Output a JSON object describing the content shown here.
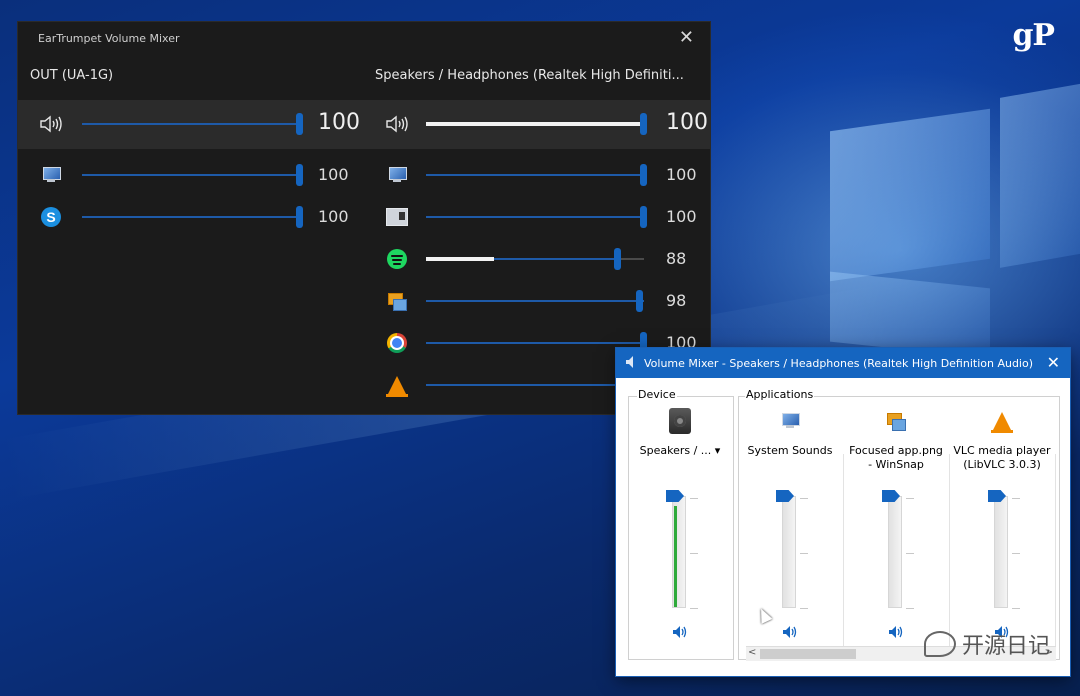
{
  "desktop": {
    "logo_text": "gP"
  },
  "eartrumpet": {
    "title": "EarTrumpet Volume Mixer",
    "close_glyph": "✕",
    "devices": [
      {
        "name": "OUT (UA-1G)",
        "master_volume": "100",
        "master_level": 1.0,
        "apps": [
          {
            "icon": "system-sounds-icon",
            "volume": "100",
            "level": 1.0
          },
          {
            "icon": "skype-icon",
            "volume": "100",
            "level": 1.0
          }
        ]
      },
      {
        "name": "Speakers / Headphones (Realtek High Definiti...",
        "master_volume": "100",
        "master_level": 1.0,
        "apps": [
          {
            "icon": "system-sounds-icon",
            "volume": "100",
            "level": 1.0
          },
          {
            "icon": "app-window-icon",
            "volume": "100",
            "level": 1.0
          },
          {
            "icon": "spotify-icon",
            "volume": "88",
            "level": 0.88
          },
          {
            "icon": "winsnap-icon",
            "volume": "98",
            "level": 0.98
          },
          {
            "icon": "chrome-icon",
            "volume": "100",
            "level": 1.0
          },
          {
            "icon": "vlc-icon",
            "volume": "",
            "level": 1.0
          }
        ]
      }
    ]
  },
  "volume_mixer": {
    "title": "Volume Mixer - Speakers / Headphones (Realtek High Definition Audio)",
    "close_glyph": "✕",
    "device_label": "Device",
    "apps_label": "Applications",
    "device": {
      "label": "Speakers / ...",
      "dropdown_glyph": "▾",
      "icon": "speaker-icon",
      "level": 1.0,
      "meter": 0.95
    },
    "applications": [
      {
        "label": "System Sounds",
        "icon": "system-sounds-icon",
        "level": 1.0
      },
      {
        "label": "Focused app.png - WinSnap",
        "icon": "winsnap-icon",
        "level": 1.0
      },
      {
        "label": "VLC media player (LibVLC 3.0.3)",
        "icon": "vlc-icon",
        "level": 1.0
      }
    ],
    "scroll_left": "<",
    "scroll_right": ">"
  },
  "watermark": {
    "text": "开源日记"
  }
}
